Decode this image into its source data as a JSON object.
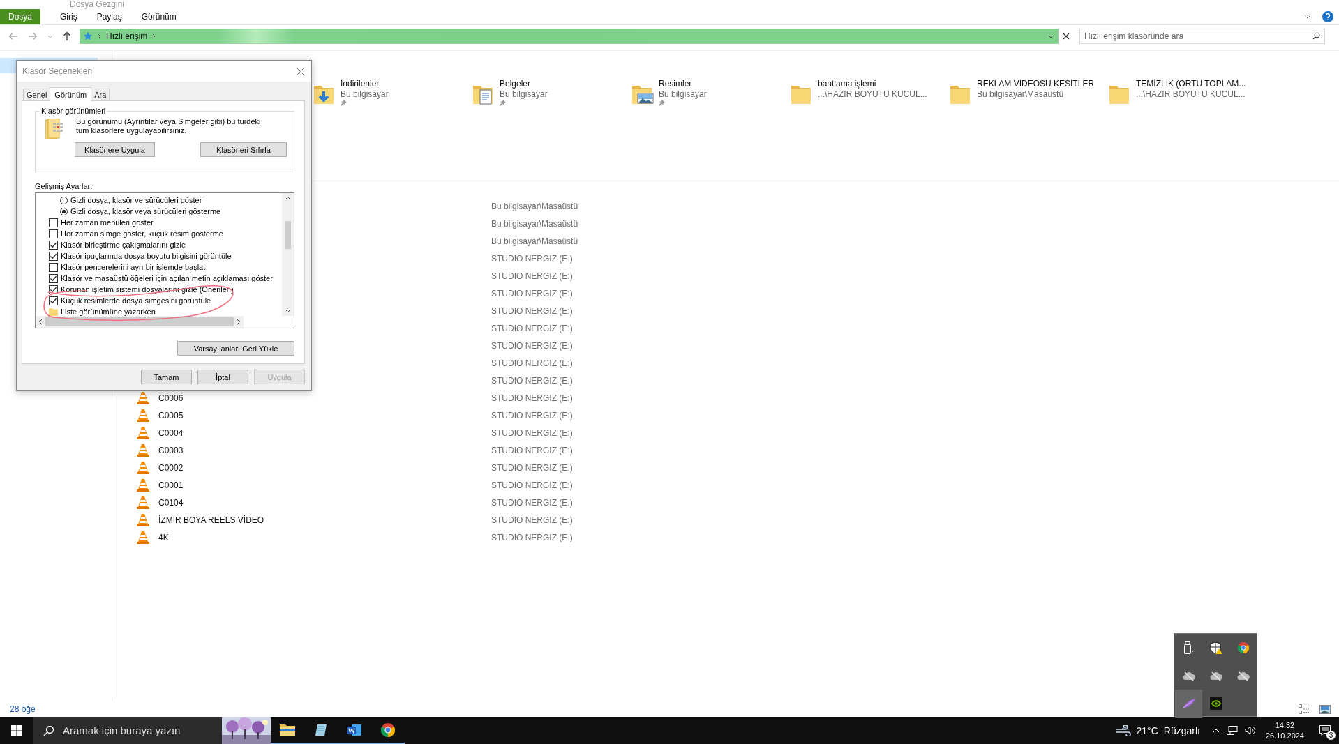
{
  "window": {
    "title": "Dosya Gezgini"
  },
  "ribbon_tabs": [
    {
      "label": "Dosya",
      "selected": true
    },
    {
      "label": "Giriş",
      "selected": false
    },
    {
      "label": "Paylaş",
      "selected": false
    },
    {
      "label": "Görünüm",
      "selected": false
    }
  ],
  "address": {
    "path": "Hızlı erişim"
  },
  "search": {
    "placeholder": "Hızlı erişim klasöründe ara"
  },
  "quick_access": [
    {
      "name": "İndirilenler",
      "location": "Bu bilgisayar",
      "pinned": true,
      "kind": "downloads"
    },
    {
      "name": "Belgeler",
      "location": "Bu bilgisayar",
      "pinned": true,
      "kind": "documents"
    },
    {
      "name": "Resimler",
      "location": "Bu bilgisayar",
      "pinned": true,
      "kind": "pictures"
    },
    {
      "name": "bantlama işlemi",
      "location": "...\\HAZIR BOYUTU KUCUL...",
      "pinned": false,
      "kind": "folder"
    },
    {
      "name": "REKLAM VİDEOSU KESİTLER",
      "location": "Bu bilgisayar\\Masaüstü",
      "pinned": false,
      "kind": "folder"
    },
    {
      "name": "TEMİZLİK (ORTU TOPLAM...",
      "location": "...\\HAZIR BOYUTU KUCUL...",
      "pinned": false,
      "kind": "folder"
    }
  ],
  "recent_files": [
    {
      "location": "Bu bilgisayar\\Masaüstü"
    },
    {
      "location": "Bu bilgisayar\\Masaüstü"
    },
    {
      "location": "Bu bilgisayar\\Masaüstü"
    },
    {
      "location": "STUDIO NERGIZ (E:)"
    },
    {
      "location": "STUDIO NERGIZ (E:)"
    },
    {
      "location": "STUDIO NERGIZ (E:)"
    },
    {
      "location": "STUDIO NERGIZ (E:)"
    },
    {
      "location": "STUDIO NERGIZ (E:)"
    },
    {
      "location": "STUDIO NERGIZ (E:)"
    },
    {
      "location": "STUDIO NERGIZ (E:)"
    },
    {
      "location": "STUDIO NERGIZ (E:)"
    },
    {
      "name": "C0006",
      "location": "STUDIO NERGIZ (E:)"
    },
    {
      "name": "C0005",
      "location": "STUDIO NERGIZ (E:)"
    },
    {
      "name": "C0004",
      "location": "STUDIO NERGIZ (E:)"
    },
    {
      "name": "C0003",
      "location": "STUDIO NERGIZ (E:)"
    },
    {
      "name": "C0002",
      "location": "STUDIO NERGIZ (E:)"
    },
    {
      "name": "C0001",
      "location": "STUDIO NERGIZ (E:)"
    },
    {
      "name": "C0104",
      "location": "STUDIO NERGIZ (E:)"
    },
    {
      "name": "İZMİR BOYA REELS VİDEO",
      "location": "STUDIO NERGIZ (E:)"
    },
    {
      "name": "4K",
      "location": "STUDIO NERGIZ (E:)"
    }
  ],
  "status_bar": {
    "item_count": "28 öğe"
  },
  "dialog": {
    "title": "Klasör Seçenekleri",
    "tabs": [
      {
        "label": "Genel",
        "selected": false
      },
      {
        "label": "Görünüm",
        "selected": true
      },
      {
        "label": "Ara",
        "selected": false
      }
    ],
    "folder_views": {
      "title": "Klasör görünümleri",
      "description": "Bu görünümü (Ayrıntılar veya Simgeler gibi) bu türdeki tüm klasörlere uygulayabilirsiniz.",
      "buttons": [
        "Klasörlere Uygula",
        "Klasörleri Sıfırla"
      ]
    },
    "advanced_label": "Gelişmiş Ayarlar:",
    "settings": [
      {
        "kind": "radio",
        "label": "Gizli dosya, klasör ve sürücüleri göster",
        "checked": false
      },
      {
        "kind": "radio",
        "label": "Gizli dosya, klasör veya sürücüleri gösterme",
        "checked": true
      },
      {
        "kind": "checkbox",
        "label": "Her zaman menüleri göster",
        "checked": false
      },
      {
        "kind": "checkbox",
        "label": "Her zaman simge göster, küçük resim gösterme",
        "checked": false
      },
      {
        "kind": "checkbox",
        "label": "Klasör birleştirme çakışmalarını gizle",
        "checked": true
      },
      {
        "kind": "checkbox",
        "label": "Klasör ipuçlarında dosya boyutu bilgisini görüntüle",
        "checked": true
      },
      {
        "kind": "checkbox",
        "label": "Klasör pencerelerini ayrı bir işlemde başlat",
        "checked": false
      },
      {
        "kind": "checkbox",
        "label": "Klasör ve masaüstü öğeleri için açılan metin açıklaması göster",
        "checked": true
      },
      {
        "kind": "checkbox",
        "label": "Korunan işletim sistemi dosyalarını gizle (Önerilen)",
        "checked": true
      },
      {
        "kind": "checkbox",
        "label": "Küçük resimlerde dosya simgesini görüntüle",
        "checked": true
      },
      {
        "kind": "folder",
        "label": "Liste görünümüne yazarken"
      }
    ],
    "restore_button": "Varsayılanları Geri Yükle",
    "buttons": [
      {
        "label": "Tamam",
        "disabled": false
      },
      {
        "label": "İptal",
        "disabled": false
      },
      {
        "label": "Uygula",
        "disabled": true
      }
    ]
  },
  "tray_overflow": [
    {
      "kind": "usb",
      "highlighted": false
    },
    {
      "kind": "shield",
      "highlighted": false
    },
    {
      "kind": "browser",
      "highlighted": false
    },
    {
      "kind": "cloud-off",
      "highlighted": false
    },
    {
      "kind": "cloud-off",
      "highlighted": false
    },
    {
      "kind": "cloud-off",
      "highlighted": false
    },
    {
      "kind": "feather",
      "highlighted": true
    },
    {
      "kind": "gpu",
      "highlighted": false
    }
  ],
  "taskbar": {
    "search_placeholder": "Aramak için buraya yazın",
    "apps": [
      {
        "kind": "explorer",
        "running": true
      },
      {
        "kind": "notes",
        "running": true
      },
      {
        "kind": "word",
        "running": true
      },
      {
        "kind": "browser",
        "running": true
      }
    ],
    "weather": {
      "temperature": "21°C",
      "condition": "Rüzgarlı"
    },
    "time": "14:32",
    "date": "26.10.2024",
    "notification_count": "3"
  }
}
